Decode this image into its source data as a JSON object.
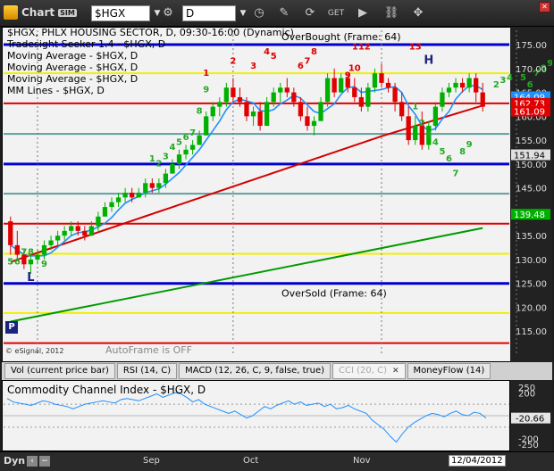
{
  "toolbar": {
    "title": "Chart",
    "badge": "SIM",
    "symbol": "$HGX",
    "interval": "D",
    "buttons": [
      "settings-icon",
      "clock-icon",
      "pencil-icon",
      "refresh-icon",
      "get-icon",
      "play-icon",
      "link-icon"
    ],
    "get_label": "GET"
  },
  "legend": [
    "$HGX, PHLX HOUSING SECTOR, D, 09:30-16:00 (Dynamic)",
    "Tradesight Seeker 1.4 - $HGX, D",
    "Moving Average - $HGX, D",
    "Moving Average - $HGX, D",
    "Moving Average - $HGX, D",
    "MM Lines - $HGX, D"
  ],
  "overbought_label": "OverBought (Frame: 64)",
  "oversold_label": "OverSold (Frame: 64)",
  "autoframe_label": "AutoFrame is OFF",
  "copyright": "© eSignal, 2012",
  "logo_letter": "P",
  "tabs": [
    {
      "label": "Vol (current price bar)",
      "active": false
    },
    {
      "label": "RSI (14, C)",
      "active": false
    },
    {
      "label": "MACD (12, 26, C, 9, false, true)",
      "active": false
    },
    {
      "label": "CCI (20, C)",
      "active": true
    },
    {
      "label": "MoneyFlow (14)",
      "active": false
    }
  ],
  "cci_title": "Commodity Channel Index - $HGX, D",
  "bottom": {
    "dyn_label": "Dyn",
    "month_labels": [
      "Sep",
      "Oct",
      "Nov"
    ],
    "date": "12/04/2012"
  },
  "colors": {
    "up_candle": "#00b000",
    "down_candle": "#e00000",
    "ma_fast": "#1e90ff",
    "ma_mid": "#d40000",
    "ma_slow": "#009a00",
    "mm_blue": "#0000cc",
    "mm_red": "#e00000",
    "mm_yellow": "#f0f000",
    "mm_teal": "#5f9ea0",
    "seeker_green": "#22aa22",
    "seeker_red": "#dd0000"
  },
  "chart_data": {
    "type": "candlestick",
    "ylim": [
      110,
      178
    ],
    "y_ticks": [
      115,
      120,
      125,
      130,
      135,
      140,
      145,
      150,
      155,
      160,
      165,
      170,
      175
    ],
    "x_labels": [
      "Sep",
      "Oct",
      "Nov"
    ],
    "ohlc": [
      [
        138,
        139,
        131,
        133
      ],
      [
        133,
        136,
        130,
        131
      ],
      [
        131,
        132,
        128,
        129
      ],
      [
        129,
        131,
        127,
        130
      ],
      [
        130,
        132,
        129,
        131
      ],
      [
        131,
        134,
        130,
        133
      ],
      [
        133,
        135,
        132,
        134
      ],
      [
        134,
        136,
        133,
        135
      ],
      [
        135,
        137,
        134,
        136
      ],
      [
        136,
        138,
        135,
        137
      ],
      [
        137,
        138,
        135,
        136
      ],
      [
        136,
        137,
        134,
        135
      ],
      [
        135,
        138,
        135,
        137
      ],
      [
        137,
        140,
        136,
        139
      ],
      [
        139,
        142,
        139,
        141
      ],
      [
        141,
        143,
        140,
        142
      ],
      [
        142,
        144,
        141,
        143
      ],
      [
        143,
        145,
        142,
        144
      ],
      [
        144,
        145,
        142,
        143
      ],
      [
        143,
        145,
        143,
        144
      ],
      [
        144,
        147,
        143,
        146
      ],
      [
        146,
        147,
        144,
        145
      ],
      [
        145,
        147,
        144,
        146
      ],
      [
        146,
        149,
        145,
        148
      ],
      [
        148,
        151,
        148,
        150
      ],
      [
        150,
        153,
        149,
        152
      ],
      [
        152,
        154,
        151,
        153
      ],
      [
        153,
        155,
        152,
        154
      ],
      [
        154,
        157,
        154,
        156
      ],
      [
        156,
        161,
        156,
        160
      ],
      [
        160,
        163,
        159,
        162
      ],
      [
        162,
        164,
        160,
        163
      ],
      [
        163,
        167,
        162,
        166
      ],
      [
        166,
        168,
        163,
        164
      ],
      [
        164,
        166,
        162,
        163
      ],
      [
        163,
        164,
        159,
        160
      ],
      [
        160,
        162,
        158,
        161
      ],
      [
        161,
        163,
        157,
        158
      ],
      [
        158,
        164,
        158,
        163
      ],
      [
        163,
        166,
        162,
        165
      ],
      [
        165,
        167,
        163,
        166
      ],
      [
        166,
        168,
        164,
        165
      ],
      [
        165,
        166,
        162,
        163
      ],
      [
        163,
        164,
        159,
        160
      ],
      [
        160,
        162,
        157,
        158
      ],
      [
        158,
        160,
        156,
        159
      ],
      [
        159,
        164,
        159,
        163
      ],
      [
        163,
        169,
        162,
        168
      ],
      [
        168,
        170,
        164,
        165
      ],
      [
        165,
        169,
        165,
        168
      ],
      [
        168,
        169,
        165,
        166
      ],
      [
        166,
        168,
        163,
        164
      ],
      [
        164,
        166,
        161,
        162
      ],
      [
        162,
        167,
        161,
        166
      ],
      [
        166,
        170,
        165,
        169
      ],
      [
        169,
        171,
        166,
        167
      ],
      [
        167,
        168,
        165,
        166
      ],
      [
        166,
        167,
        161,
        163
      ],
      [
        163,
        165,
        159,
        160
      ],
      [
        160,
        162,
        154,
        155
      ],
      [
        155,
        160,
        154,
        158
      ],
      [
        158,
        161,
        153,
        154
      ],
      [
        154,
        159,
        153,
        158
      ],
      [
        158,
        163,
        157,
        162
      ],
      [
        162,
        166,
        161,
        165
      ],
      [
        165,
        167,
        164,
        166
      ],
      [
        166,
        168,
        165,
        167
      ],
      [
        167,
        168,
        165,
        166
      ],
      [
        166,
        169,
        165,
        168
      ],
      [
        168,
        169,
        163,
        165
      ],
      [
        165,
        167,
        161,
        162
      ]
    ],
    "overbought": 175,
    "oversold": 125,
    "mm_lines": [
      {
        "value": 175.0,
        "color": "blue"
      },
      {
        "value": 169.0,
        "color": "yellow"
      },
      {
        "value": 162.7,
        "color": "red"
      },
      {
        "value": 156.3,
        "color": "teal"
      },
      {
        "value": 150.0,
        "color": "blue"
      },
      {
        "value": 143.8,
        "color": "teal"
      },
      {
        "value": 137.5,
        "color": "red"
      },
      {
        "value": 131.2,
        "color": "yellow"
      },
      {
        "value": 125.0,
        "color": "blue"
      },
      {
        "value": 118.8,
        "color": "yellow"
      },
      {
        "value": 112.5,
        "color": "red"
      }
    ],
    "price_labels": [
      {
        "value": "164.09",
        "level": 164.09,
        "bg": "#1e90ff",
        "color": "#ffffff"
      },
      {
        "value": "162.73",
        "level": 162.73,
        "bg": "#e00000",
        "color": "#ffffff"
      },
      {
        "value": "161.09",
        "level": 161.09,
        "bg": "#e00000",
        "color": "#ffffff"
      },
      {
        "value": "151.94",
        "level": 151.94,
        "bg": "#e0e0e0",
        "color": "#000000"
      },
      {
        "value": "139.48",
        "level": 139.48,
        "bg": "#00b000",
        "color": "#ffffff"
      }
    ],
    "seeker_labels": [
      {
        "text": "1",
        "bar": 29,
        "price": 168.5,
        "color": "red"
      },
      {
        "text": "2",
        "bar": 33,
        "price": 171.0,
        "color": "red"
      },
      {
        "text": "3",
        "bar": 36,
        "price": 170.0,
        "color": "red"
      },
      {
        "text": "4",
        "bar": 38,
        "price": 173.0,
        "color": "red"
      },
      {
        "text": "5",
        "bar": 39,
        "price": 172.0,
        "color": "red"
      },
      {
        "text": "6",
        "bar": 43,
        "price": 170.0,
        "color": "red"
      },
      {
        "text": "7",
        "bar": 44,
        "price": 171.0,
        "color": "red"
      },
      {
        "text": "8",
        "bar": 45,
        "price": 173.0,
        "color": "red"
      },
      {
        "text": "9",
        "bar": 50,
        "price": 168.0,
        "color": "red"
      },
      {
        "text": "10",
        "bar": 51,
        "price": 169.5,
        "color": "red"
      },
      {
        "text": "112",
        "bar": 52,
        "price": 174.0,
        "color": "red"
      },
      {
        "text": "13",
        "bar": 60,
        "price": 174.0,
        "color": "red"
      },
      {
        "text": "H",
        "bar": 62,
        "price": 171.0,
        "color": "blue"
      },
      {
        "text": "L",
        "bar": 3,
        "price": 125.5,
        "color": "blue"
      },
      {
        "text": "5",
        "bar": 0,
        "price": 129.0,
        "color": "green"
      },
      {
        "text": "6",
        "bar": 1,
        "price": 129.0,
        "color": "green"
      },
      {
        "text": "7",
        "bar": 2,
        "price": 131.0,
        "color": "green"
      },
      {
        "text": "8",
        "bar": 3,
        "price": 131.0,
        "color": "green"
      },
      {
        "text": "9",
        "bar": 5,
        "price": 128.5,
        "color": "green"
      },
      {
        "text": "1",
        "bar": 21,
        "price": 150.5,
        "color": "green"
      },
      {
        "text": "2",
        "bar": 22,
        "price": 149.5,
        "color": "green"
      },
      {
        "text": "3",
        "bar": 23,
        "price": 151.0,
        "color": "green"
      },
      {
        "text": "4",
        "bar": 24,
        "price": 153.0,
        "color": "green"
      },
      {
        "text": "5",
        "bar": 25,
        "price": 154.0,
        "color": "green"
      },
      {
        "text": "6",
        "bar": 26,
        "price": 155.0,
        "color": "green"
      },
      {
        "text": "7",
        "bar": 27,
        "price": 156.0,
        "color": "green"
      },
      {
        "text": "8",
        "bar": 28,
        "price": 160.5,
        "color": "green"
      },
      {
        "text": "9",
        "bar": 29,
        "price": 165.0,
        "color": "green"
      },
      {
        "text": "1",
        "bar": 60,
        "price": 161.5,
        "color": "green"
      },
      {
        "text": "2",
        "bar": 61,
        "price": 158.0,
        "color": "green"
      },
      {
        "text": "3",
        "bar": 62,
        "price": 155.5,
        "color": "green"
      },
      {
        "text": "4",
        "bar": 63,
        "price": 154.0,
        "color": "green"
      },
      {
        "text": "5",
        "bar": 64,
        "price": 152.0,
        "color": "green"
      },
      {
        "text": "6",
        "bar": 65,
        "price": 150.5,
        "color": "green"
      },
      {
        "text": "7",
        "bar": 66,
        "price": 147.5,
        "color": "green"
      },
      {
        "text": "8",
        "bar": 67,
        "price": 152.0,
        "color": "green"
      },
      {
        "text": "9",
        "bar": 68,
        "price": 153.5,
        "color": "green"
      },
      {
        "text": "2",
        "bar": 72,
        "price": 166.0,
        "color": "green"
      },
      {
        "text": "3",
        "bar": 73,
        "price": 167.0,
        "color": "green"
      },
      {
        "text": "4",
        "bar": 74,
        "price": 167.5,
        "color": "green"
      },
      {
        "text": "5",
        "bar": 76,
        "price": 167.5,
        "color": "green"
      },
      {
        "text": "6",
        "bar": 77,
        "price": 166.0,
        "color": "green"
      },
      {
        "text": "7",
        "bar": 78,
        "price": 168.5,
        "color": "green"
      },
      {
        "text": "8",
        "bar": 79,
        "price": 169.5,
        "color": "green"
      },
      {
        "text": "9",
        "bar": 80,
        "price": 170.5,
        "color": "green"
      }
    ],
    "cci": {
      "ylim": [
        -280,
        280
      ],
      "ticks": [
        250,
        200,
        100,
        0,
        -100,
        -200,
        -250
      ],
      "current_label": "-20.66",
      "current": -20.66,
      "values": [
        150,
        120,
        110,
        100,
        90,
        110,
        130,
        120,
        100,
        90,
        80,
        60,
        80,
        100,
        110,
        120,
        130,
        120,
        110,
        140,
        150,
        140,
        130,
        150,
        170,
        190,
        160,
        180,
        200,
        190,
        160,
        120,
        140,
        100,
        80,
        60,
        40,
        20,
        40,
        10,
        -20,
        0,
        40,
        80,
        60,
        90,
        110,
        130,
        100,
        120,
        90,
        100,
        110,
        80,
        100,
        60,
        70,
        90,
        60,
        40,
        20,
        -40,
        -80,
        -120,
        -180,
        -230,
        -160,
        -100,
        -60,
        -30,
        0,
        20,
        10,
        -10,
        20,
        40,
        10,
        0,
        30,
        20,
        -20
      ]
    }
  }
}
